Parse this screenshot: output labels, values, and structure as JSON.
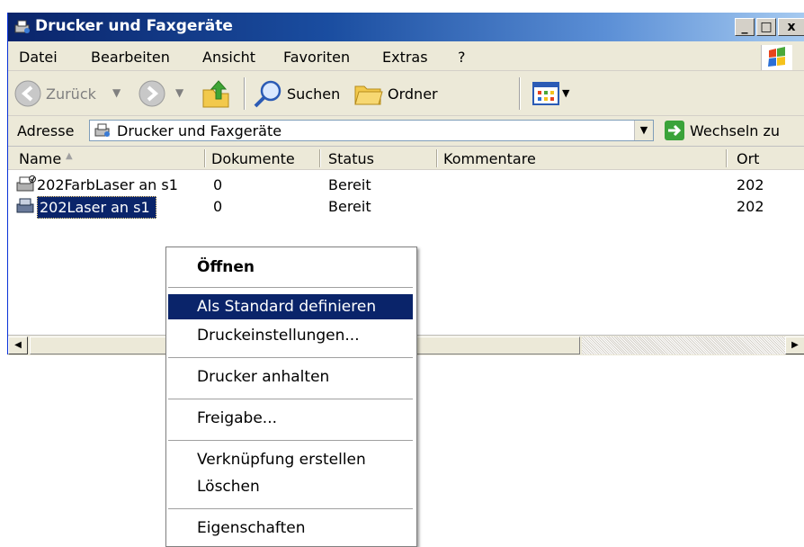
{
  "window": {
    "title": "Drucker und Faxgeräte",
    "caption_buttons": [
      "_",
      "□",
      "x"
    ]
  },
  "menubar": {
    "items": [
      "Datei",
      "Bearbeiten",
      "Ansicht",
      "Favoriten",
      "Extras",
      "?"
    ]
  },
  "toolbar": {
    "back_label": "Zurück",
    "search_label": "Suchen",
    "folders_label": "Ordner"
  },
  "address": {
    "label": "Adresse",
    "value": "Drucker und Faxgeräte",
    "go_label": "Wechseln zu"
  },
  "list": {
    "columns": [
      "Name",
      "Dokumente",
      "Status",
      "Kommentare",
      "Ort"
    ],
    "rows": [
      {
        "name": "202FarbLaser an s1",
        "docs": "0",
        "status": "Bereit",
        "comment": "",
        "location": "202"
      },
      {
        "name": "202Laser an s1",
        "docs": "0",
        "status": "Bereit",
        "comment": "",
        "location": "202"
      }
    ]
  },
  "context_menu": {
    "items": [
      "Öffnen",
      "Als Standard definieren",
      "Druckeinstellungen...",
      "Drucker anhalten",
      "Freigabe...",
      "Verknüpfung erstellen",
      "Löschen",
      "Eigenschaften"
    ]
  },
  "colors": {
    "titlebar": "#0a246a",
    "chrome": "#ece9d8",
    "highlight": "#0a246a"
  },
  "icons": [
    "printer-fax-icon",
    "back-icon",
    "forward-icon",
    "up-folder-icon",
    "search-icon",
    "folders-icon",
    "views-icon",
    "go-arrow-icon",
    "windows-logo-icon",
    "printer-icon",
    "sort-asc-icon"
  ]
}
